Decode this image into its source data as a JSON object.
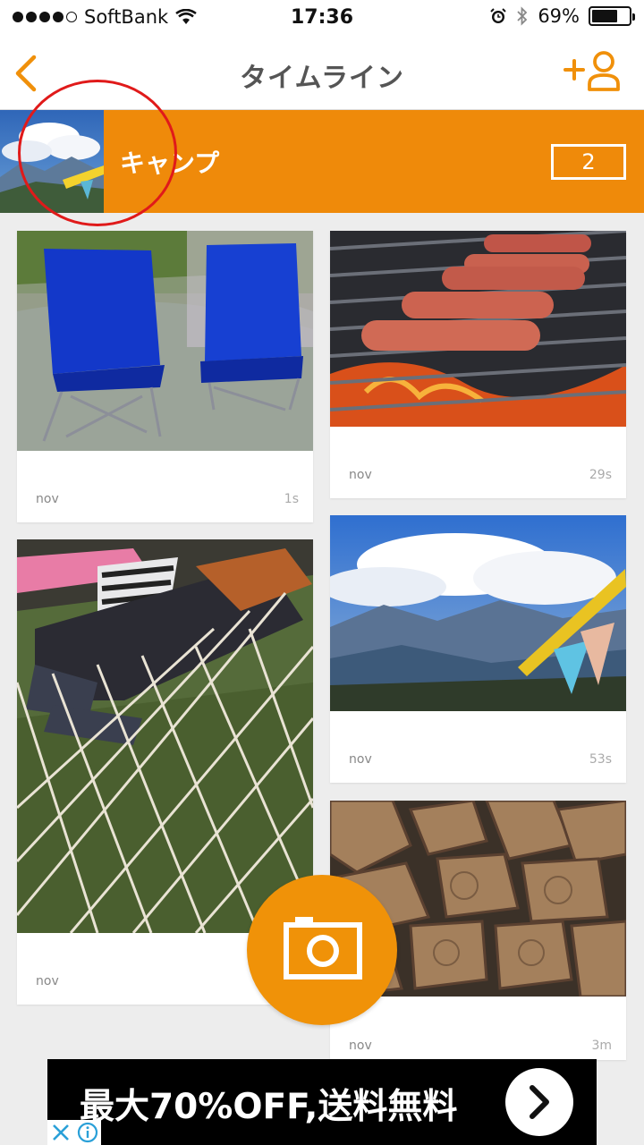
{
  "status_bar": {
    "carrier": "SoftBank",
    "time": "17:36",
    "battery": "69%",
    "battery_level": 0.69,
    "signal_bars": 4
  },
  "nav": {
    "title": "タイムライン",
    "accent_color": "#f0900a"
  },
  "group": {
    "name": "キャンプ",
    "count": "2",
    "banner_color": "#ef8a0a"
  },
  "posts": [
    {
      "photo": "camping-chairs",
      "author": "nov",
      "age": "1s"
    },
    {
      "photo": "grilled-sausages",
      "author": "nov",
      "age": "29s"
    },
    {
      "photo": "hammock",
      "author": "nov",
      "age": ""
    },
    {
      "photo": "mountain-view",
      "author": "nov",
      "age": "53s"
    },
    {
      "photo": "firewood",
      "author": "nov",
      "age": "3m"
    }
  ],
  "ad": {
    "text": "最大70%OFF,送料無料"
  }
}
